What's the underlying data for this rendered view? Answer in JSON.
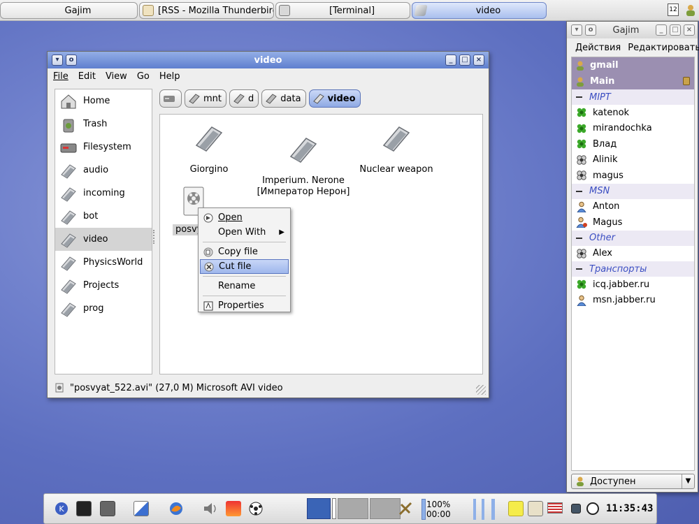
{
  "taskbar": {
    "tasks": [
      {
        "label": "Gajim"
      },
      {
        "label": "[RSS - Mozilla Thunderbird]"
      },
      {
        "label": "[Terminal]"
      },
      {
        "label": "video"
      }
    ],
    "calendar_day": "12"
  },
  "filemanager": {
    "title": "video",
    "menu": [
      "File",
      "Edit",
      "View",
      "Go",
      "Help"
    ],
    "sidebar": [
      {
        "label": "Home",
        "icon": "home-icon"
      },
      {
        "label": "Trash",
        "icon": "trash-icon"
      },
      {
        "label": "Filesystem",
        "icon": "drive-icon"
      },
      {
        "label": "audio",
        "icon": "folder-icon"
      },
      {
        "label": "incoming",
        "icon": "folder-icon"
      },
      {
        "label": "bot",
        "icon": "folder-icon"
      },
      {
        "label": "video",
        "icon": "folder-icon",
        "selected": true
      },
      {
        "label": "PhysicsWorld",
        "icon": "folder-icon"
      },
      {
        "label": "Projects",
        "icon": "folder-icon"
      },
      {
        "label": "prog",
        "icon": "folder-icon"
      }
    ],
    "path": [
      "mnt",
      "d",
      "data",
      "video"
    ],
    "files": [
      {
        "label": "Giorgino"
      },
      {
        "label": "Imperium. Nerone\n[Император Нерон]"
      },
      {
        "label": "Nuclear weapon"
      },
      {
        "label": "posvy"
      }
    ],
    "status": "\"posvyat_522.avi\" (27,0 M) Microsoft AVI video"
  },
  "context_menu": {
    "items": [
      {
        "label": "Open",
        "icon": "open-icon"
      },
      {
        "label": "Open With",
        "submenu": true
      },
      {
        "label": "Copy file",
        "icon": "copy-icon",
        "sep_before": true
      },
      {
        "label": "Cut file",
        "icon": "cut-icon",
        "selected": true
      },
      {
        "label": "Rename",
        "sep_before": true
      },
      {
        "label": "Properties",
        "icon": "properties-icon",
        "sep_before": true
      }
    ]
  },
  "gajim": {
    "title": "Gajim",
    "menu": [
      "Действия",
      "Редактировать"
    ],
    "accounts": [
      "gmail",
      "Main"
    ],
    "groups": [
      {
        "name": "MIPT",
        "contacts": [
          {
            "name": "katenok",
            "status": "online"
          },
          {
            "name": "mirandochka",
            "status": "online"
          },
          {
            "name": "Влад",
            "status": "online"
          },
          {
            "name": "Alinik",
            "status": "away"
          },
          {
            "name": "magus",
            "status": "away"
          }
        ]
      },
      {
        "name": "MSN",
        "contacts": [
          {
            "name": "Anton",
            "status": "person"
          },
          {
            "name": "Magus",
            "status": "person-away"
          }
        ]
      },
      {
        "name": "Other",
        "contacts": [
          {
            "name": "Alex",
            "status": "away"
          }
        ]
      },
      {
        "name": "Транспорты",
        "contacts": [
          {
            "name": "icq.jabber.ru",
            "status": "online"
          },
          {
            "name": "msn.jabber.ru",
            "status": "person"
          }
        ]
      }
    ],
    "status_select": "Доступен"
  },
  "panel": {
    "battery_percent": "100%",
    "battery_time": "00:00",
    "clock": "11:35:43"
  }
}
